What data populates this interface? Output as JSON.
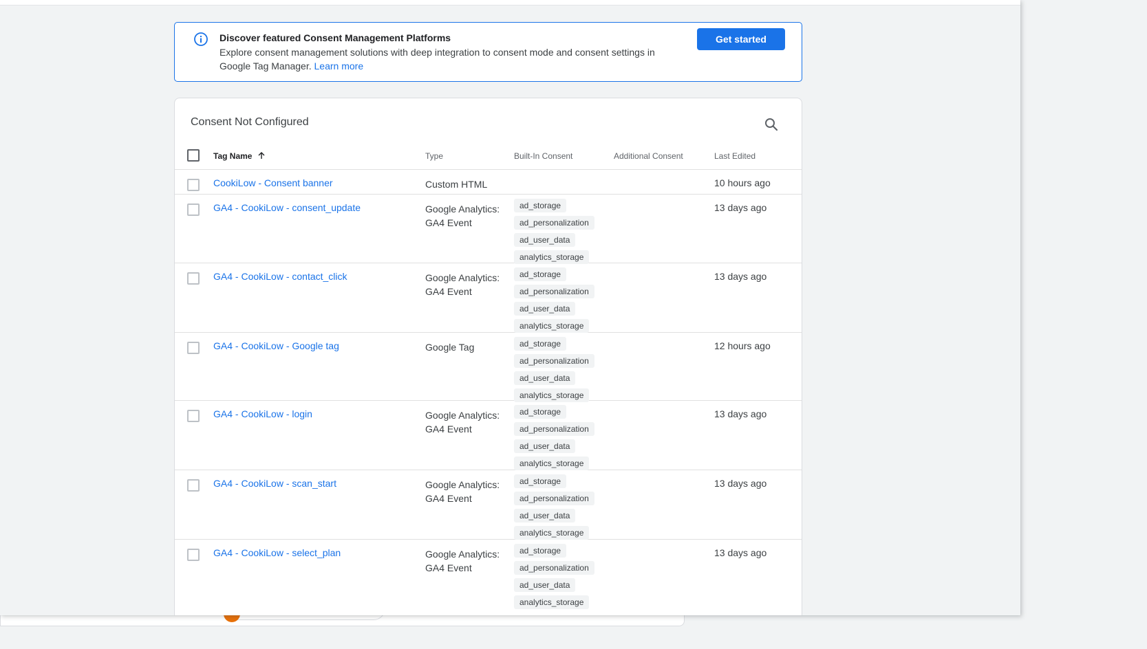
{
  "banner": {
    "title": "Discover featured Consent Management Platforms",
    "text": "Explore consent management solutions with deep integration to consent mode and consent settings in Google Tag Manager.",
    "learn_more": "Learn more",
    "cta": "Get started",
    "icon": "info-icon"
  },
  "table": {
    "title": "Consent Not Configured",
    "search_icon": "search-icon",
    "columns": {
      "name": "Tag Name",
      "type": "Type",
      "builtin": "Built-In Consent",
      "additional": "Additional Consent",
      "edited": "Last Edited"
    },
    "sort": "ascending",
    "rows": [
      {
        "name": "CookiLow - Consent banner",
        "type": "Custom HTML",
        "consent": [],
        "edited": "10 hours ago"
      },
      {
        "name": "GA4 - CookiLow - consent_update",
        "type": "Google Analytics: GA4 Event",
        "consent": [
          "ad_storage",
          "ad_personalization",
          "ad_user_data",
          "analytics_storage"
        ],
        "edited": "13 days ago"
      },
      {
        "name": "GA4 - CookiLow - contact_click",
        "type": "Google Analytics: GA4 Event",
        "consent": [
          "ad_storage",
          "ad_personalization",
          "ad_user_data",
          "analytics_storage"
        ],
        "edited": "13 days ago"
      },
      {
        "name": "GA4 - CookiLow - Google tag",
        "type": "Google Tag",
        "consent": [
          "ad_storage",
          "ad_personalization",
          "ad_user_data",
          "analytics_storage"
        ],
        "edited": "12 hours ago"
      },
      {
        "name": "GA4 - CookiLow - login",
        "type": "Google Analytics: GA4 Event",
        "consent": [
          "ad_storage",
          "ad_personalization",
          "ad_user_data",
          "analytics_storage"
        ],
        "edited": "13 days ago"
      },
      {
        "name": "GA4 - CookiLow - scan_start",
        "type": "Google Analytics: GA4 Event",
        "consent": [
          "ad_storage",
          "ad_personalization",
          "ad_user_data",
          "analytics_storage"
        ],
        "edited": "13 days ago"
      },
      {
        "name": "GA4 - CookiLow - select_plan",
        "type": "Google Analytics: GA4 Event",
        "consent": [
          "ad_storage",
          "ad_personalization",
          "ad_user_data",
          "analytics_storage"
        ],
        "edited": "13 days ago"
      }
    ]
  },
  "colors": {
    "accent": "#1a73e8",
    "background": "#f1f3f4",
    "chip": "#f1f3f4"
  }
}
